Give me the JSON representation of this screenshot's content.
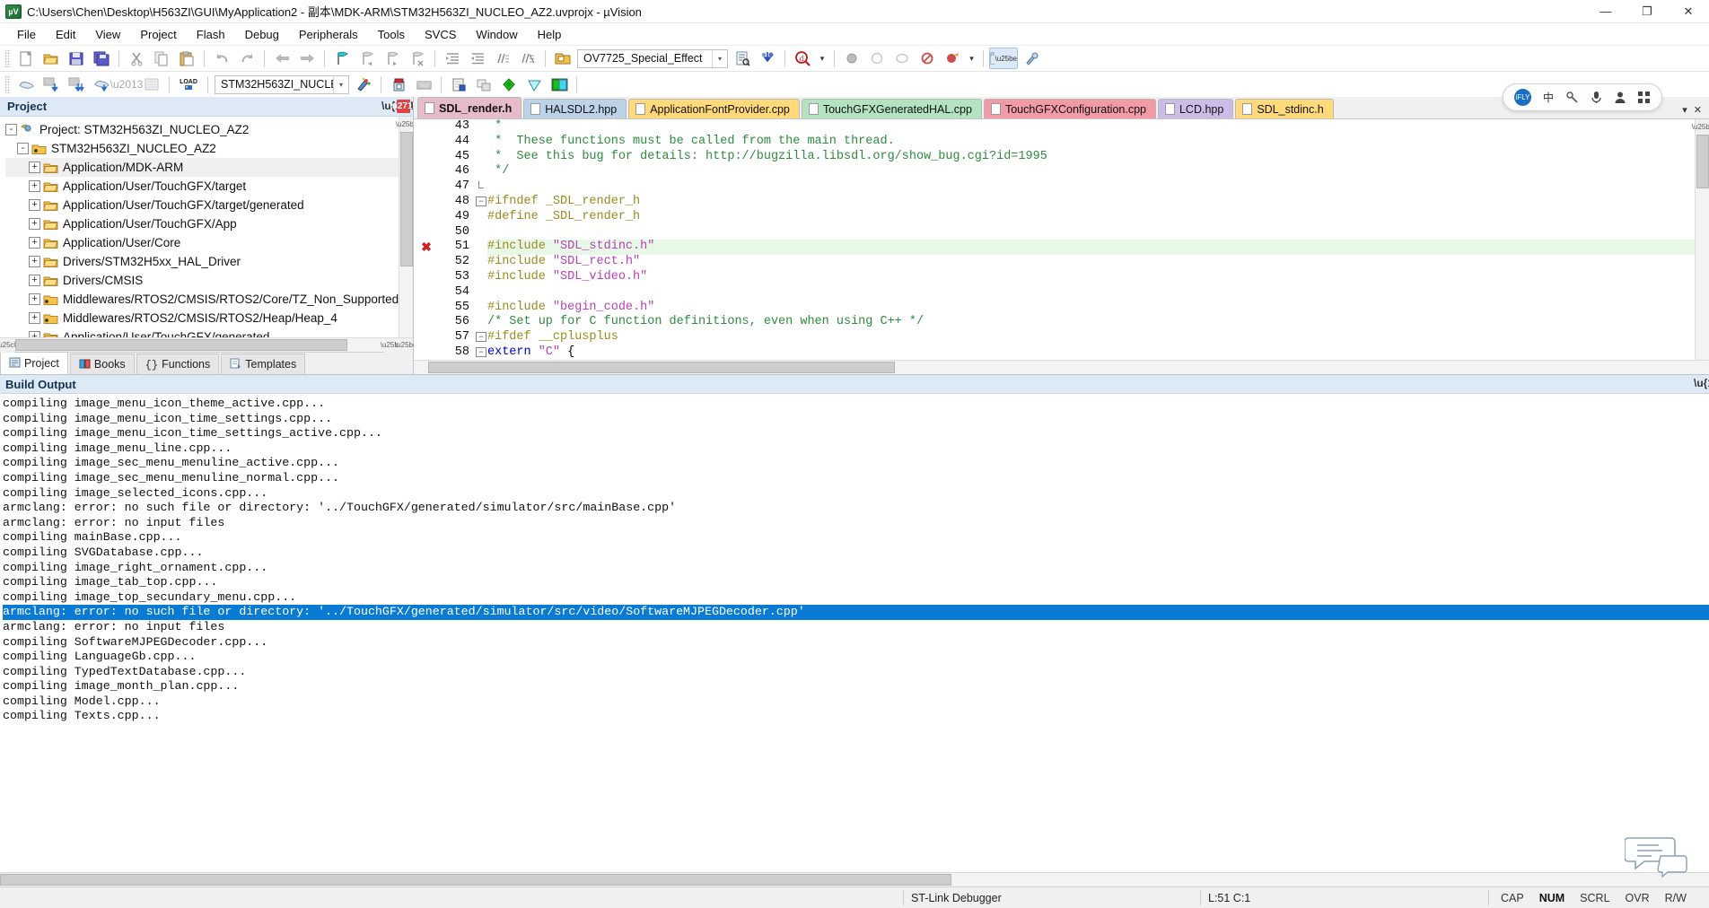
{
  "window": {
    "title": "C:\\Users\\Chen\\Desktop\\H563ZI\\GUI\\MyApplication2 - 副本\\MDK-ARM\\STM32H563ZI_NUCLEO_AZ2.uvprojx - µVision",
    "app_icon": "uvision-icon",
    "minimize": "—",
    "maximize": "❐",
    "close": "✕"
  },
  "menu": {
    "items": [
      "File",
      "Edit",
      "View",
      "Project",
      "Flash",
      "Debug",
      "Peripherals",
      "Tools",
      "SVCS",
      "Window",
      "Help"
    ]
  },
  "toolbar1": {
    "buttons": [
      {
        "name": "new-file-button",
        "label": "New"
      },
      {
        "name": "open-file-button",
        "label": "Open"
      },
      {
        "name": "save-button",
        "label": "Save"
      },
      {
        "name": "save-all-button",
        "label": "Save All"
      },
      {
        "name": "cut-button",
        "label": "Cut"
      },
      {
        "name": "copy-button",
        "label": "Copy"
      },
      {
        "name": "paste-button",
        "label": "Paste"
      },
      {
        "name": "undo-button",
        "label": "Undo"
      },
      {
        "name": "redo-button",
        "label": "Redo"
      },
      {
        "name": "navigate-back-button",
        "label": "Back"
      },
      {
        "name": "navigate-forward-button",
        "label": "Forward"
      },
      {
        "name": "insert-bookmark-button",
        "label": "Insert/Remove Bookmark"
      },
      {
        "name": "prev-bookmark-button",
        "label": "Previous Bookmark"
      },
      {
        "name": "next-bookmark-button",
        "label": "Next Bookmark"
      },
      {
        "name": "clear-bookmarks-button",
        "label": "Clear All Bookmarks"
      },
      {
        "name": "indent-button",
        "label": "Indent"
      },
      {
        "name": "outdent-button",
        "label": "Outdent"
      },
      {
        "name": "comment-button",
        "label": "Comment"
      },
      {
        "name": "uncomment-button",
        "label": "Uncomment"
      },
      {
        "name": "open-folder-button",
        "label": "Open Folder"
      }
    ],
    "search_combo_value": "OV7725_Special_Effect",
    "search_combo_arrow": "▾",
    "find-in-files-button": "Find in Files",
    "bookmarks-button": "Bookmarks",
    "find-button": "Find",
    "find_dropdown_arrow": "▾",
    "debug-stop-button": "Stop"
  },
  "toolbar2": {
    "target_combo_value": "STM32H563ZI_NUCLEO_AZ2",
    "target_combo_arrow": "▾",
    "buttons": [
      {
        "name": "translate-button",
        "label": "Translate"
      },
      {
        "name": "build-button",
        "label": "Build"
      },
      {
        "name": "rebuild-button",
        "label": "Rebuild"
      },
      {
        "name": "batch-build-button",
        "label": "Batch Build"
      },
      {
        "name": "stop-build-button",
        "label": "Stop Build"
      },
      {
        "name": "download-button",
        "label": "LOAD"
      },
      {
        "name": "target-options-button",
        "label": "Options for Target"
      },
      {
        "name": "manage-project-items-button",
        "label": "Manage Project Items"
      },
      {
        "name": "pack-installer-button",
        "label": "Pack Installer"
      },
      {
        "name": "configuration-wizard-button",
        "label": "Configuration Wizard"
      },
      {
        "name": "start-debug-button",
        "label": "Start/Stop Debug Session"
      },
      {
        "name": "multi-project-button",
        "label": "Multi-Project"
      }
    ]
  },
  "project_panel": {
    "caption": "Project",
    "pin_icon": "pin-icon",
    "close_icon": "close-icon",
    "tree": [
      {
        "depth": 0,
        "expander": "-",
        "icon": "project-icon",
        "label": "Project: STM32H563ZI_NUCLEO_AZ2",
        "selected": false
      },
      {
        "depth": 1,
        "expander": "-",
        "icon": "target-icon",
        "label": "STM32H563ZI_NUCLEO_AZ2",
        "selected": false
      },
      {
        "depth": 2,
        "expander": "+",
        "icon": "folder-icon",
        "label": "Application/MDK-ARM",
        "selected": true
      },
      {
        "depth": 2,
        "expander": "+",
        "icon": "folder-icon",
        "label": "Application/User/TouchGFX/target",
        "selected": false
      },
      {
        "depth": 2,
        "expander": "+",
        "icon": "folder-icon",
        "label": "Application/User/TouchGFX/target/generated",
        "selected": false
      },
      {
        "depth": 2,
        "expander": "+",
        "icon": "folder-icon",
        "label": "Application/User/TouchGFX/App",
        "selected": false
      },
      {
        "depth": 2,
        "expander": "+",
        "icon": "folder-icon",
        "label": "Application/User/Core",
        "selected": false
      },
      {
        "depth": 2,
        "expander": "+",
        "icon": "folder-icon",
        "label": "Drivers/STM32H5xx_HAL_Driver",
        "selected": false
      },
      {
        "depth": 2,
        "expander": "+",
        "icon": "folder-icon",
        "label": "Drivers/CMSIS",
        "selected": false
      },
      {
        "depth": 2,
        "expander": "+",
        "icon": "folder-pack-icon",
        "label": "Middlewares/RTOS2/CMSIS/RTOS2/Core/TZ_Non_Supported",
        "selected": false
      },
      {
        "depth": 2,
        "expander": "+",
        "icon": "folder-pack-icon",
        "label": "Middlewares/RTOS2/CMSIS/RTOS2/Heap/Heap_4",
        "selected": false
      },
      {
        "depth": 2,
        "expander": "+",
        "icon": "folder-icon",
        "label": "Application/User/TouchGFX/generated",
        "selected": false
      }
    ],
    "bottom_tabs": [
      {
        "name": "tab-project",
        "label": "Project",
        "icon": "project-tab-icon",
        "active": true
      },
      {
        "name": "tab-books",
        "label": "Books",
        "icon": "books-tab-icon",
        "active": false
      },
      {
        "name": "tab-functions",
        "label": "Functions",
        "icon": "functions-tab-icon",
        "active": false
      },
      {
        "name": "tab-templates",
        "label": "Templates",
        "icon": "templates-tab-icon",
        "active": false
      }
    ]
  },
  "editor": {
    "tabs": [
      {
        "label": "SDL_render.h",
        "color": "#e6bcc8",
        "active": true
      },
      {
        "label": "HALSDL2.hpp",
        "color": "#bcd2e8",
        "active": false
      },
      {
        "label": "ApplicationFontProvider.cpp",
        "color": "#ffd97a",
        "active": false
      },
      {
        "label": "TouchGFXGeneratedHAL.cpp",
        "color": "#b4e3c2",
        "active": false
      },
      {
        "label": "TouchGFXConfiguration.cpp",
        "color": "#f29aa6",
        "active": false
      },
      {
        "label": "LCD.hpp",
        "color": "#cdbce8",
        "active": false
      },
      {
        "label": "SDL_stdinc.h",
        "color": "#ffd97a",
        "active": false
      }
    ],
    "tab_scroll_down": "▾",
    "tab_close": "✕",
    "lines": [
      {
        "num": "43",
        "fold": "",
        "bp": false,
        "hl": false,
        "segs": [
          {
            "t": " *",
            "c": "cmt"
          }
        ]
      },
      {
        "num": "44",
        "fold": "",
        "bp": false,
        "hl": false,
        "segs": [
          {
            "t": " *  These functions must be called from the main thread.",
            "c": "cmt"
          }
        ]
      },
      {
        "num": "45",
        "fold": "",
        "bp": false,
        "hl": false,
        "segs": [
          {
            "t": " *  See this bug for details: http://bugzilla.libsdl.org/show_bug.cgi?id=1995",
            "c": "cmt"
          }
        ]
      },
      {
        "num": "46",
        "fold": "",
        "bp": false,
        "hl": false,
        "segs": [
          {
            "t": " */",
            "c": "cmt"
          }
        ]
      },
      {
        "num": "47",
        "fold": "end",
        "bp": false,
        "hl": false,
        "segs": [
          {
            "t": "",
            "c": ""
          }
        ]
      },
      {
        "num": "48",
        "fold": "-",
        "bp": false,
        "hl": false,
        "segs": [
          {
            "t": "#ifndef _SDL_render_h",
            "c": "pre"
          }
        ]
      },
      {
        "num": "49",
        "fold": "",
        "bp": false,
        "hl": false,
        "segs": [
          {
            "t": "#define _SDL_render_h",
            "c": "pre"
          }
        ]
      },
      {
        "num": "50",
        "fold": "",
        "bp": false,
        "hl": false,
        "segs": [
          {
            "t": "",
            "c": ""
          }
        ]
      },
      {
        "num": "51",
        "fold": "",
        "bp": true,
        "hl": true,
        "segs": [
          {
            "t": "#include ",
            "c": "pre"
          },
          {
            "t": "\"SDL_stdinc.h\"",
            "c": "str"
          }
        ]
      },
      {
        "num": "52",
        "fold": "",
        "bp": false,
        "hl": false,
        "segs": [
          {
            "t": "#include ",
            "c": "pre"
          },
          {
            "t": "\"SDL_rect.h\"",
            "c": "str"
          }
        ]
      },
      {
        "num": "53",
        "fold": "",
        "bp": false,
        "hl": false,
        "segs": [
          {
            "t": "#include ",
            "c": "pre"
          },
          {
            "t": "\"SDL_video.h\"",
            "c": "str"
          }
        ]
      },
      {
        "num": "54",
        "fold": "",
        "bp": false,
        "hl": false,
        "segs": [
          {
            "t": "",
            "c": ""
          }
        ]
      },
      {
        "num": "55",
        "fold": "",
        "bp": false,
        "hl": false,
        "segs": [
          {
            "t": "#include ",
            "c": "pre"
          },
          {
            "t": "\"begin_code.h\"",
            "c": "str"
          }
        ]
      },
      {
        "num": "56",
        "fold": "",
        "bp": false,
        "hl": false,
        "segs": [
          {
            "t": "/* Set up for C function definitions, even when using C++ */",
            "c": "cmt"
          }
        ]
      },
      {
        "num": "57",
        "fold": "-",
        "bp": false,
        "hl": false,
        "segs": [
          {
            "t": "#ifdef __cplusplus",
            "c": "pre"
          }
        ]
      },
      {
        "num": "58",
        "fold": "-",
        "bp": false,
        "hl": false,
        "segs": [
          {
            "t": "extern ",
            "c": "kw"
          },
          {
            "t": "\"C\"",
            "c": "str"
          },
          {
            "t": " {",
            "c": ""
          }
        ]
      }
    ]
  },
  "build_output": {
    "caption": "Build Output",
    "pin_icon": "pin-icon",
    "lines": [
      {
        "text": "compiling image_menu_icon_theme_active.cpp...",
        "sel": false
      },
      {
        "text": "compiling image_menu_icon_time_settings.cpp...",
        "sel": false
      },
      {
        "text": "compiling image_menu_icon_time_settings_active.cpp...",
        "sel": false
      },
      {
        "text": "compiling image_menu_line.cpp...",
        "sel": false
      },
      {
        "text": "compiling image_sec_menu_menuline_active.cpp...",
        "sel": false
      },
      {
        "text": "compiling image_sec_menu_menuline_normal.cpp...",
        "sel": false
      },
      {
        "text": "compiling image_selected_icons.cpp...",
        "sel": false
      },
      {
        "text": "armclang: error: no such file or directory: '../TouchGFX/generated/simulator/src/mainBase.cpp'",
        "sel": false
      },
      {
        "text": "armclang: error: no input files",
        "sel": false
      },
      {
        "text": "compiling mainBase.cpp...",
        "sel": false
      },
      {
        "text": "compiling SVGDatabase.cpp...",
        "sel": false
      },
      {
        "text": "compiling image_right_ornament.cpp...",
        "sel": false
      },
      {
        "text": "compiling image_tab_top.cpp...",
        "sel": false
      },
      {
        "text": "compiling image_top_secundary_menu.cpp...",
        "sel": false
      },
      {
        "text": "armclang: error: no such file or directory: '../TouchGFX/generated/simulator/src/video/SoftwareMJPEGDecoder.cpp'",
        "sel": true
      },
      {
        "text": "armclang: error: no input files",
        "sel": false
      },
      {
        "text": "compiling SoftwareMJPEGDecoder.cpp...",
        "sel": false
      },
      {
        "text": "compiling LanguageGb.cpp...",
        "sel": false
      },
      {
        "text": "compiling TypedTextDatabase.cpp...",
        "sel": false
      },
      {
        "text": "compiling image_month_plan.cpp...",
        "sel": false
      },
      {
        "text": "compiling Model.cpp...",
        "sel": false
      },
      {
        "text": "compiling Texts.cpp...",
        "sel": false
      }
    ]
  },
  "ime_bar": {
    "logo": "iFLY",
    "items": [
      "中",
      "●",
      "mic-icon",
      "user-icon",
      "apps-icon"
    ]
  },
  "statusbar": {
    "debugger": "ST-Link Debugger",
    "position": "L:51 C:1",
    "flags": [
      "CAP",
      "NUM",
      "SCRL",
      "OVR",
      "R/W"
    ]
  },
  "colors": {
    "accent": "#0a7bd4",
    "caption_bg": "#ddeaf6",
    "error_red": "#d02020",
    "comment_green": "#2e8b3d",
    "preproc_olive": "#9a8b1e",
    "string_magenta": "#b83fb8",
    "keyword_blue": "#0000c8",
    "highlight_line": "#e7f8e7"
  }
}
